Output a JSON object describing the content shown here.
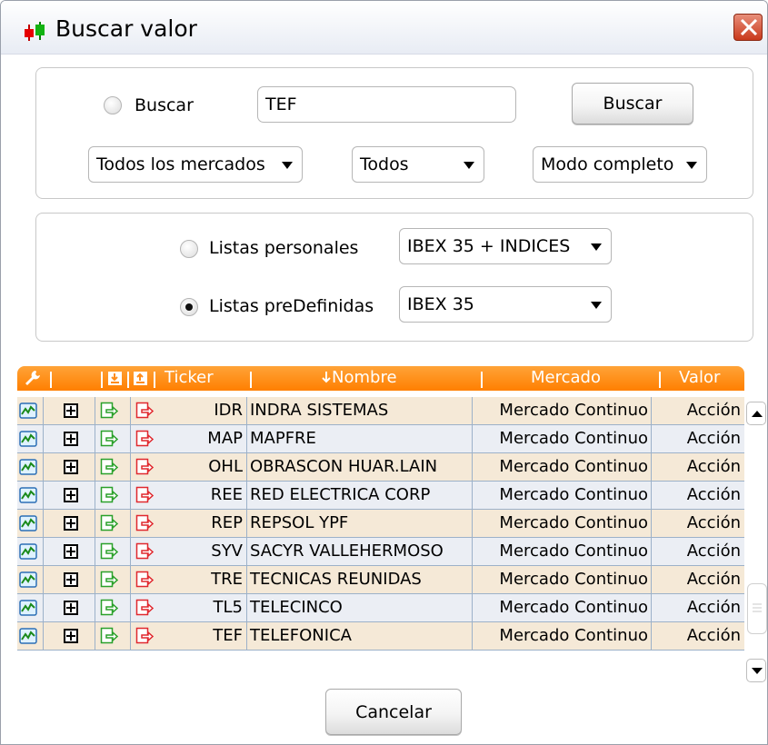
{
  "window": {
    "title": "Buscar valor",
    "icon": "candlestick-icon",
    "close_icon": "close-icon"
  },
  "search_group": {
    "radio_label": "Buscar",
    "radio_checked": false,
    "search_value": "TEF",
    "search_button": "Buscar",
    "market_select": "Todos los mercados",
    "type_select": "Todos",
    "mode_select": "Modo completo"
  },
  "lists_group": {
    "personal_label": "Listas personales",
    "personal_checked": false,
    "personal_select": "IBEX 35 + INDICES",
    "predefined_label": "Listas preDefinidas",
    "predefined_checked": true,
    "predefined_select": "IBEX 35"
  },
  "table": {
    "header_icons": [
      "wrench-icon",
      "import-icon",
      "export-icon"
    ],
    "columns": {
      "ticker": "Ticker",
      "nombre": "Nombre",
      "mercado": "Mercado",
      "valor": "Valor"
    },
    "sort_icon": "sort-down-icon",
    "rows": [
      {
        "ticker": "IDR",
        "nombre": "INDRA SISTEMAS",
        "mercado": "Mercado Continuo",
        "valor": "Acción"
      },
      {
        "ticker": "MAP",
        "nombre": "MAPFRE",
        "mercado": "Mercado Continuo",
        "valor": "Acción"
      },
      {
        "ticker": "OHL",
        "nombre": "OBRASCON HUAR.LAIN",
        "mercado": "Mercado Continuo",
        "valor": "Acción"
      },
      {
        "ticker": "REE",
        "nombre": "RED ELECTRICA CORP",
        "mercado": "Mercado Continuo",
        "valor": "Acción"
      },
      {
        "ticker": "REP",
        "nombre": "REPSOL YPF",
        "mercado": "Mercado Continuo",
        "valor": "Acción"
      },
      {
        "ticker": "SYV",
        "nombre": "SACYR VALLEHERMOSO",
        "mercado": "Mercado Continuo",
        "valor": "Acción"
      },
      {
        "ticker": "TRE",
        "nombre": "TECNICAS REUNIDAS",
        "mercado": "Mercado Continuo",
        "valor": "Acción"
      },
      {
        "ticker": "TL5",
        "nombre": "TELECINCO",
        "mercado": "Mercado Continuo",
        "valor": "Acción"
      },
      {
        "ticker": "TEF",
        "nombre": "TELEFONICA",
        "mercado": "Mercado Continuo",
        "valor": "Acción"
      }
    ]
  },
  "footer": {
    "cancel_button": "Cancelar"
  },
  "colors": {
    "header_orange": "#ff8c1a",
    "row_odd": "#f5e9d7",
    "row_even": "#ebeef4",
    "grid_line": "#9cb1c9",
    "close_red": "#d9532f"
  }
}
